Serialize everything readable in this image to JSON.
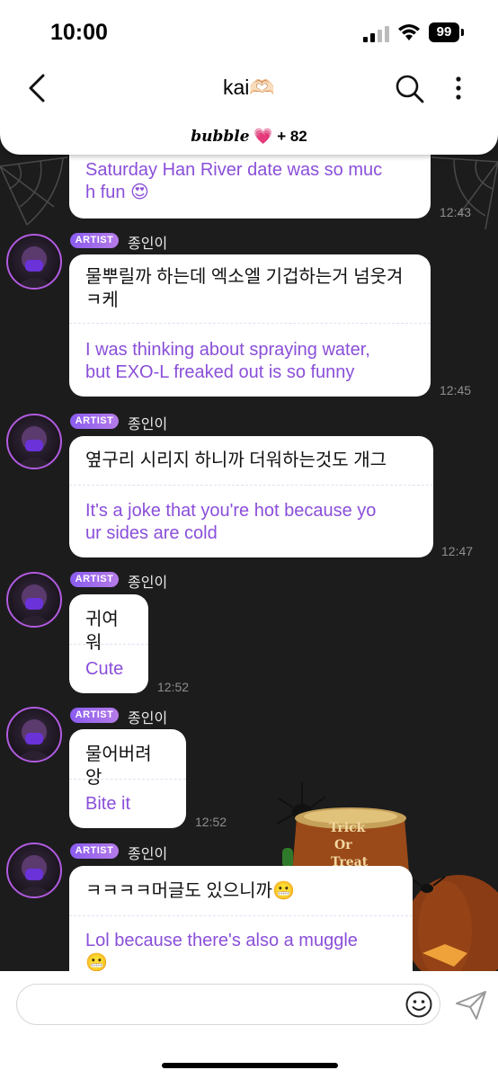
{
  "status_bar": {
    "time": "10:00",
    "battery": "99"
  },
  "header": {
    "title": "kai🫶🏻",
    "bubble_word": "bubble",
    "bubble_heart": "💗",
    "bubble_count": "+ 82"
  },
  "messages": [
    {
      "korean": "",
      "english_lines": [
        "Saturday Han River date was so muc",
        "h fun 😍"
      ],
      "time": "12:43"
    },
    {
      "artist_tag": "ARTIST",
      "sender": "종인이",
      "korean_lines": [
        "물뿌릴까 하는데 엑소엘 기겁하는거 넘웃겨",
        "ㅋ케"
      ],
      "english_lines": [
        "I was thinking about spraying water,",
        "but EXO-L freaked out is so funny"
      ],
      "time": "12:45"
    },
    {
      "artist_tag": "ARTIST",
      "sender": "종인이",
      "korean_lines": [
        "옆구리 시리지 하니까 더워하는것도 개그"
      ],
      "english_lines": [
        "It's a joke that you're hot because yo",
        "ur sides are cold"
      ],
      "time": "12:47"
    },
    {
      "artist_tag": "ARTIST",
      "sender": "종인이",
      "korean_lines": [
        "귀여워"
      ],
      "english_lines": [
        "Cute"
      ],
      "time": "12:52"
    },
    {
      "artist_tag": "ARTIST",
      "sender": "종인이",
      "korean_lines": [
        "물어버려 앙"
      ],
      "english_lines": [
        "Bite it"
      ],
      "time": "12:52"
    },
    {
      "artist_tag": "ARTIST",
      "sender": "종인이",
      "korean_lines": [
        "ㅋㅋㅋㅋ머글도 있으니까😬"
      ],
      "english_lines": [
        "Lol because there's also a muggle",
        "😬"
      ],
      "time": ""
    }
  ],
  "background": {
    "pumpkin_text": [
      "Trick",
      "Or",
      "Treat"
    ]
  },
  "composer": {
    "placeholder": ""
  },
  "colors": {
    "accent": "#8a4fd9",
    "avatar_ring": "#b15be0",
    "background": "#1b1b1c"
  },
  "icons": [
    "back-chevron-icon",
    "search-icon",
    "more-vertical-icon",
    "emoji-icon",
    "send-icon",
    "signal-icon",
    "wifi-icon",
    "battery-icon"
  ]
}
